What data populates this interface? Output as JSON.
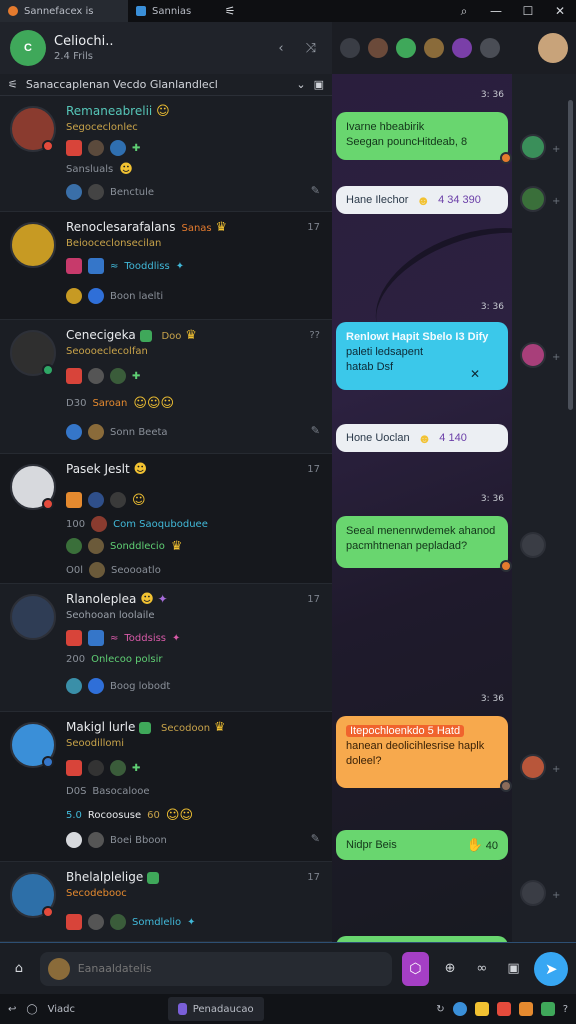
{
  "titlebar": {
    "tabs": [
      {
        "label": "Sannefacex is"
      },
      {
        "label": "Sannias"
      }
    ],
    "icons": [
      "pin-icon",
      "search-icon",
      "minimize-icon",
      "maximize-icon",
      "close-icon"
    ]
  },
  "left_header": {
    "name": "Celiochi..",
    "subtitle": "2.4 Frils",
    "icons": [
      "chevron-left-icon",
      "shuffle-icon"
    ]
  },
  "filter_bar": {
    "text": "Sanaccaplenan Vecdo Glanlandlecl",
    "icons": [
      "filter-icon",
      "chevron-down-icon",
      "compose-icon"
    ]
  },
  "chats": [
    {
      "name": "Remaneabrelii",
      "preview": "Segoceclonlec",
      "line3": "Sansluals",
      "footer": "Benctule",
      "time": "",
      "avatar_color": "#8a3b2f"
    },
    {
      "name": "Renoclesarafalans",
      "tag": "Sanas",
      "time": "17",
      "preview": "Beiooceclonsecilan",
      "line3": "Tooddliss",
      "footer": "Boon laelti",
      "avatar_color": "#c79a23"
    },
    {
      "name": "Cenecigeka",
      "tag": "Doo",
      "time": "??",
      "preview": "Seoooeclecolfan",
      "line3": "Saroan",
      "line3_prefix": "D30",
      "footer": "Sonn Beeta",
      "avatar_color": "#3b3b3b"
    },
    {
      "name": "Pasek Jeslt",
      "time": "17",
      "preview": "",
      "line3": "Com Saoquboduee",
      "line3_prefix": "100",
      "line4": "Sonddlecio",
      "footer": "Seoooatlo",
      "footer_prefix": "O0l",
      "avatar_color": "#d7d9dd"
    },
    {
      "name": "Rlanoleplea",
      "time": "17",
      "preview": "Seohooan loolaile",
      "line3": "Toddsiss",
      "line4": "Onlecoo polsir",
      "line4_prefix": "200",
      "footer": "Boog lobodt",
      "avatar_color": "#2f3d55"
    },
    {
      "name": "Makigl lurle",
      "tag": "Secodoon",
      "time": "",
      "preview": "Seoodillomi",
      "line3": "Basocalooe",
      "line3_prefix": "D0S",
      "line4": "Rocoosuse",
      "line4_prefix": "5.0",
      "line4_suffix": "60",
      "footer": "Boei Bboon",
      "avatar_color": "#3a8fd8"
    },
    {
      "name": "Bhelalplelige",
      "time": "17",
      "preview": "Secodebooc",
      "line3": "Somdlelio",
      "avatar_color": "#2d6fa8"
    }
  ],
  "messages": [
    {
      "type": "time",
      "text": "3: 36"
    },
    {
      "type": "bubble",
      "color": "green",
      "lines": [
        "Ivarne hbeabirik",
        "Seegan pouncHitdeab, 8"
      ]
    },
    {
      "type": "pill",
      "text": "Hane Ilechor",
      "meta": "4 34 390"
    },
    {
      "type": "time",
      "text": "3: 36"
    },
    {
      "type": "bubble",
      "color": "cyan",
      "lines": [
        "Renlowt Hapit Sbelo I3 Dify",
        "paleti ledsapent",
        "hatab Dsf"
      ]
    },
    {
      "type": "pill",
      "text": "Hone Uoclan",
      "meta": "4 140"
    },
    {
      "type": "time",
      "text": "3: 36"
    },
    {
      "type": "bubble",
      "color": "green",
      "lines": [
        "Seeal menenrwdemek ahanod",
        "pacmhtnenan pepladad?"
      ]
    },
    {
      "type": "time",
      "text": "3: 36"
    },
    {
      "type": "bubble",
      "color": "orange",
      "lines": [
        "Itepochloenkdo 5 Hatd",
        "hanean deolicihlesrise haplk",
        "doleel?"
      ]
    },
    {
      "type": "bubble",
      "color": "green",
      "lines": [
        "Nidpr Beis"
      ],
      "meta": "40"
    }
  ],
  "composer": {
    "placeholder": "Eanaaldatelis",
    "icons": [
      "home-icon",
      "sticker-icon",
      "attach-icon",
      "link-icon",
      "media-icon",
      "send-icon"
    ]
  },
  "taskbar": {
    "left_label": "Viadc",
    "active_label": "Penadaucao",
    "icons": [
      "sync-icon",
      "circle-icon",
      "app-icon",
      "help-icon",
      "telegram-icon"
    ]
  }
}
